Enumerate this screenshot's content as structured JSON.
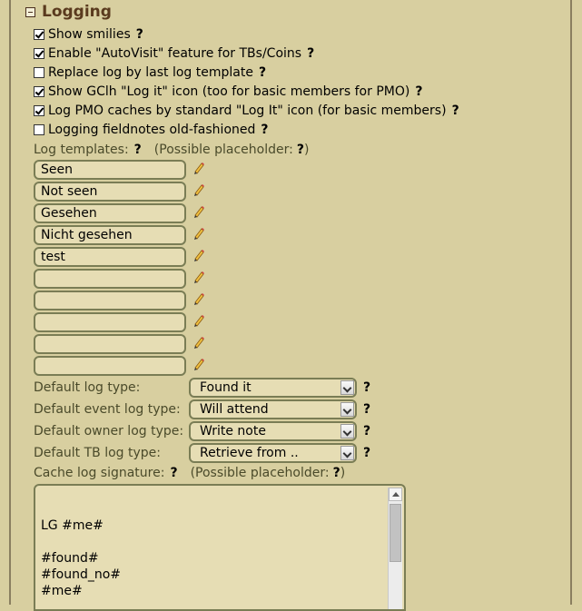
{
  "section": {
    "title": "Logging"
  },
  "help_mark": "?",
  "options": [
    {
      "label": "Show smilies",
      "checked": true
    },
    {
      "label": "Enable \"AutoVisit\" feature for TBs/Coins",
      "checked": true
    },
    {
      "label": "Replace log by last log template",
      "checked": false
    },
    {
      "label": "Show GClh \"Log it\" icon (too for basic members for PMO)",
      "checked": true
    },
    {
      "label": "Log PMO caches by standard \"Log It\" icon (for basic members)",
      "checked": true
    },
    {
      "label": "Logging fieldnotes old-fashioned",
      "checked": false
    }
  ],
  "log_templates": {
    "label": "Log templates:",
    "placeholder_text": "(Possible placeholder:",
    "closing": ")",
    "items": [
      "Seen",
      "Not seen",
      "Gesehen",
      "Nicht gesehen",
      "test",
      "",
      "",
      "",
      "",
      ""
    ],
    "edit_icon": "pencil-icon"
  },
  "selects": [
    {
      "label": "Default log type:",
      "value": "Found it"
    },
    {
      "label": "Default event log type:",
      "value": "Will attend"
    },
    {
      "label": "Default owner log type:",
      "value": "Write note"
    },
    {
      "label": "Default TB log type:",
      "value": "Retrieve from .."
    }
  ],
  "signature": {
    "label": "Cache log signature:",
    "placeholder_text": "(Possible placeholder:",
    "closing": ")",
    "lines": [
      "",
      "",
      "LG #me#",
      "",
      "#found#",
      "#found_no#",
      "#me#"
    ]
  },
  "colors": {
    "background": "#d8cfa0",
    "heading": "#5a3a1e",
    "field_border": "#7a7d55",
    "field_bg": "#e6ddb4"
  }
}
